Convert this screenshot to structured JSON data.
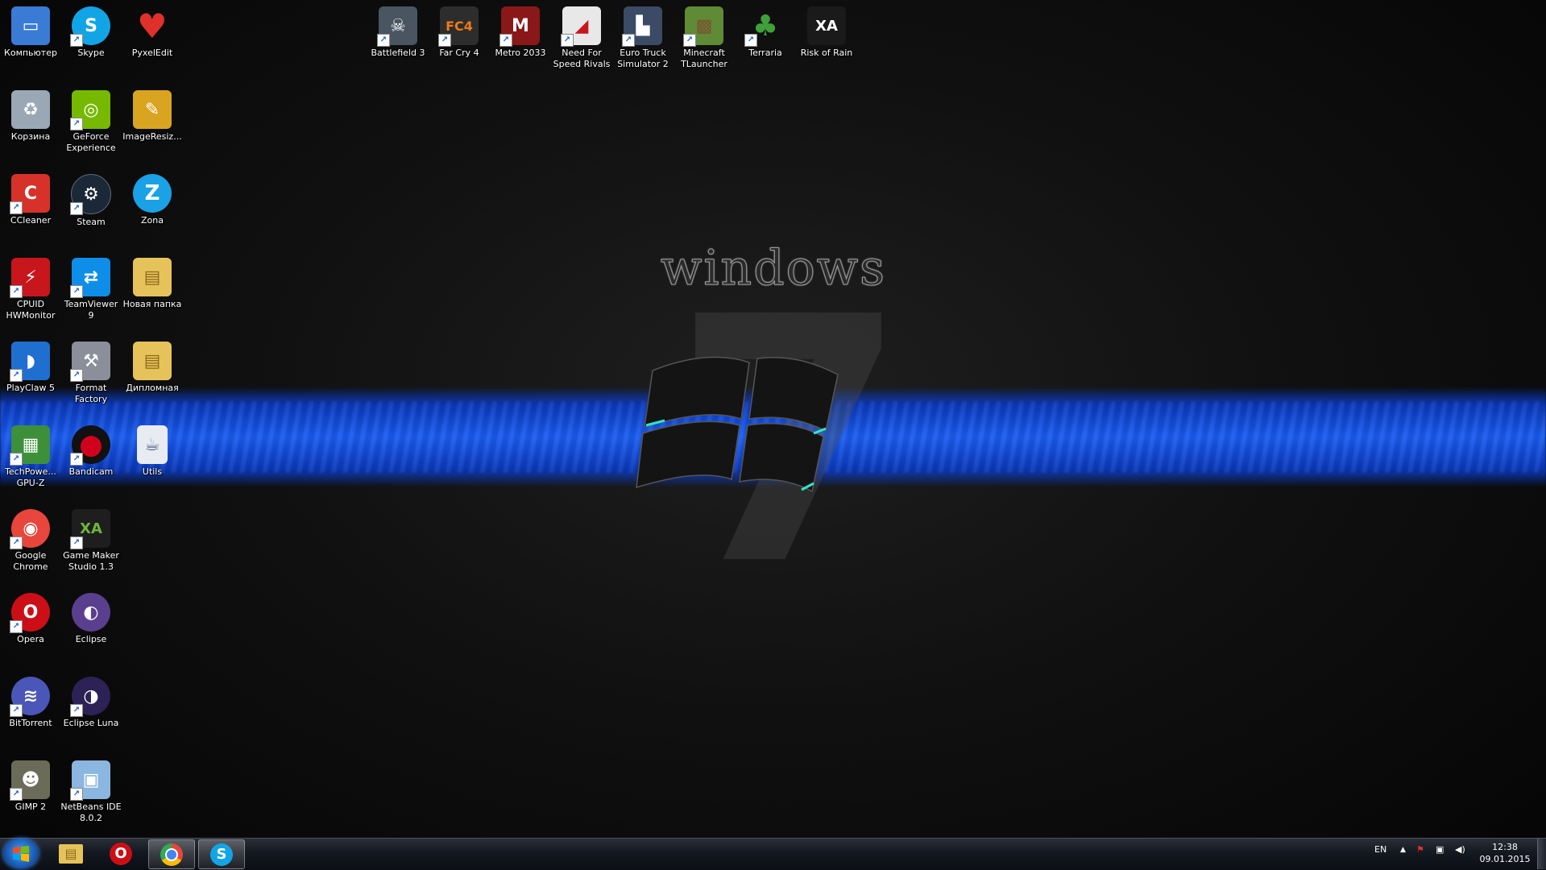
{
  "wallpaper": {
    "brand_text": "windows",
    "edition_numeral": "7"
  },
  "desktop_icons": {
    "col1": [
      {
        "label": "Компьютер",
        "icon": "computer-icon",
        "color": "#3a7bd5",
        "glyph": "▭"
      },
      {
        "label": "Корзина",
        "icon": "recycle-bin-icon",
        "color": "#9aa7b5",
        "glyph": "♻"
      },
      {
        "label": "CCleaner",
        "icon": "ccleaner-icon",
        "color": "#d6322a",
        "glyph": "C"
      },
      {
        "label": "CPUID HWMonitor",
        "icon": "hwmonitor-icon",
        "color": "#c8161d",
        "glyph": "⚡"
      },
      {
        "label": "PlayClaw 5",
        "icon": "playclaw-icon",
        "color": "#1f6fd0",
        "glyph": "◗"
      },
      {
        "label": "TechPowe... GPU-Z",
        "icon": "gpuz-icon",
        "color": "#3d8f3a",
        "glyph": "▦"
      },
      {
        "label": "Google Chrome",
        "icon": "chrome-icon",
        "color": "#e8453c",
        "glyph": "◉"
      },
      {
        "label": "Opera",
        "icon": "opera-icon",
        "color": "#cc0f16",
        "glyph": "O"
      },
      {
        "label": "BitTorrent",
        "icon": "bittorrent-icon",
        "color": "#4a56b8",
        "glyph": "≋"
      },
      {
        "label": "GIMP 2",
        "icon": "gimp-icon",
        "color": "#6b6b5a",
        "glyph": "☻"
      }
    ],
    "col2": [
      {
        "label": "Skype",
        "icon": "skype-icon",
        "color": "#12a5e6",
        "glyph": "S"
      },
      {
        "label": "GeForce Experience",
        "icon": "geforce-icon",
        "color": "#76b900",
        "glyph": "◎"
      },
      {
        "label": "Steam",
        "icon": "steam-icon",
        "color": "#1b2838",
        "glyph": "⚙"
      },
      {
        "label": "TeamViewer 9",
        "icon": "teamviewer-icon",
        "color": "#0e8ee9",
        "glyph": "⇄"
      },
      {
        "label": "Format Factory",
        "icon": "format-factory-icon",
        "color": "#8a8f99",
        "glyph": "⚒"
      },
      {
        "label": "Bandicam",
        "icon": "bandicam-icon",
        "color": "#d0021b",
        "glyph": "●"
      },
      {
        "label": "Game Maker Studio 1.3",
        "icon": "gamemaker-icon",
        "color": "#6fb53d",
        "glyph": "XA"
      },
      {
        "label": "Eclipse",
        "icon": "eclipse-icon",
        "color": "#5a3f8f",
        "glyph": "◐"
      },
      {
        "label": "Eclipse Luna",
        "icon": "eclipse-luna-icon",
        "color": "#2c2255",
        "glyph": "◑"
      },
      {
        "label": "NetBeans IDE 8.0.2",
        "icon": "netbeans-icon",
        "color": "#8ab6e0",
        "glyph": "▣"
      }
    ],
    "col3": [
      {
        "label": "PyxelEdit",
        "icon": "pyxeledit-icon",
        "color": "#e0302a",
        "glyph": "♥"
      },
      {
        "label": "ImageResiz...",
        "icon": "imageresizer-icon",
        "color": "#d9a520",
        "glyph": "✎"
      },
      {
        "label": "Zona",
        "icon": "zona-icon",
        "color": "#1aa1e6",
        "glyph": "Z"
      },
      {
        "label": "Новая папка",
        "icon": "folder-icon",
        "color": "#e6c35a",
        "glyph": "▤"
      },
      {
        "label": "Дипломная",
        "icon": "folder-icon",
        "color": "#e6c35a",
        "glyph": "▤"
      },
      {
        "label": "Utils",
        "icon": "document-icon",
        "color": "#e8ecf2",
        "glyph": "☕"
      }
    ],
    "top_row": [
      {
        "label": "Battlefield 3",
        "icon": "battlefield-icon",
        "color": "#4a5562",
        "glyph": "☠"
      },
      {
        "label": "Far Cry 4",
        "icon": "farcry4-icon",
        "color": "#2d2d2d",
        "glyph": "FC4"
      },
      {
        "label": "Metro 2033",
        "icon": "metro-icon",
        "color": "#8a1818",
        "glyph": "M"
      },
      {
        "label": "Need For Speed Rivals",
        "icon": "nfs-icon",
        "color": "#e8e8e8",
        "glyph": "◢"
      },
      {
        "label": "Euro Truck Simulator 2",
        "icon": "ets2-icon",
        "color": "#3b4b66",
        "glyph": "▙"
      },
      {
        "label": "Minecraft TLauncher",
        "icon": "minecraft-icon",
        "color": "#5f8a36",
        "glyph": "▩"
      },
      {
        "label": "Terraria",
        "icon": "terraria-icon",
        "color": "#2e6b2a",
        "glyph": "♣"
      },
      {
        "label": "Risk of Rain",
        "icon": "riskofrain-icon",
        "color": "#1a1a1a",
        "glyph": "XA"
      }
    ]
  },
  "taskbar": {
    "pinned": [
      {
        "name": "explorer",
        "icon": "folder-icon",
        "color": "#e6c35a",
        "glyph": "▤",
        "active": false
      },
      {
        "name": "opera",
        "icon": "opera-icon",
        "color": "#cc0f16",
        "glyph": "O",
        "active": false
      },
      {
        "name": "chrome",
        "icon": "chrome-icon",
        "color": "#e8453c",
        "glyph": "◉",
        "active": true
      },
      {
        "name": "skype",
        "icon": "skype-icon",
        "color": "#12a5e6",
        "glyph": "S",
        "active": true
      }
    ],
    "language": "EN",
    "time": "12:38",
    "date": "09.01.2015"
  }
}
